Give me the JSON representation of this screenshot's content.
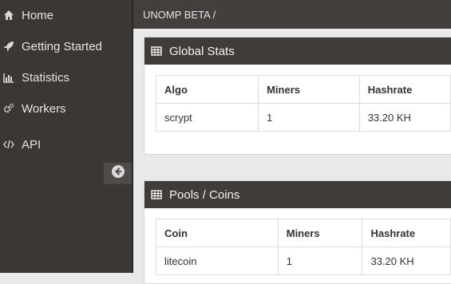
{
  "sidebar": {
    "items": [
      {
        "label": "Home",
        "icon": "home-icon"
      },
      {
        "label": "Getting Started",
        "icon": "rocket-icon"
      },
      {
        "label": "Statistics",
        "icon": "bar-chart-icon"
      },
      {
        "label": "Workers",
        "icon": "gears-icon"
      },
      {
        "label": "API",
        "icon": "code-icon"
      }
    ],
    "collapse_icon": "arrow-left-circle-icon"
  },
  "topbar": {
    "breadcrumb": "UNOMP BETA /"
  },
  "global_stats": {
    "title": "Global Stats",
    "icon": "table-icon",
    "columns": [
      "Algo",
      "Miners",
      "Hashrate"
    ],
    "rows": [
      [
        "scrypt",
        "1",
        "33.20 KH"
      ]
    ]
  },
  "pools": {
    "title": "Pools / Coins",
    "icon": "table-icon",
    "columns": [
      "Coin",
      "Miners",
      "Hashrate"
    ],
    "rows": [
      [
        "litecoin",
        "1",
        "33.20 KH"
      ]
    ]
  },
  "colors": {
    "sidebar_bg": "#3b3735",
    "header_bg": "#3f3c3a",
    "content_bg": "#e9e9e9"
  }
}
